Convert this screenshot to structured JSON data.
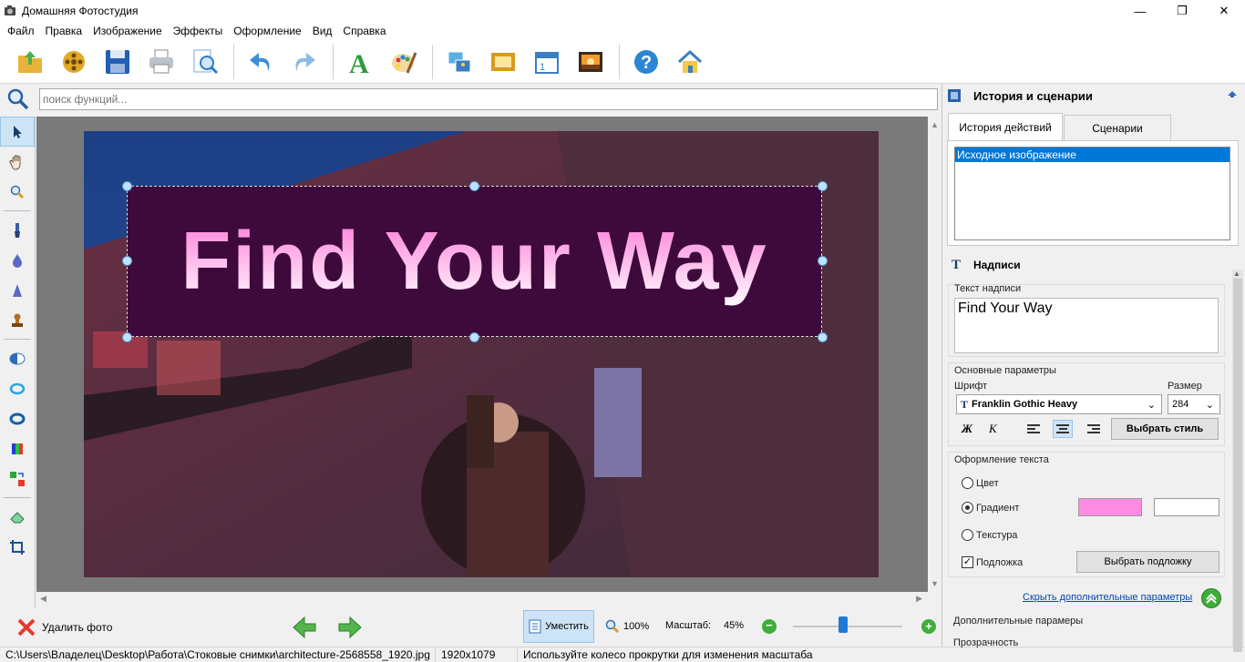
{
  "window": {
    "title": "Домашняя Фотостудия"
  },
  "menu": [
    "Файл",
    "Правка",
    "Изображение",
    "Эффекты",
    "Оформление",
    "Вид",
    "Справка"
  ],
  "toolbar_icons": [
    "open-folder-icon",
    "film-reel-icon",
    "save-icon",
    "print-icon",
    "zoom-preview-icon",
    "undo-icon",
    "redo-icon",
    "text-icon",
    "palette-icon",
    "collage-icon",
    "frame-icon",
    "calendar-icon",
    "postcard-icon",
    "help-icon",
    "home-icon"
  ],
  "search": {
    "placeholder": "поиск функций..."
  },
  "canvas": {
    "caption_text": "Find Your Way",
    "gradient_start": "#ff7ad8",
    "gradient_end": "#ffffff",
    "background_color": "#3e0a3c"
  },
  "bottom": {
    "delete_label": "Удалить фото",
    "fit_label": "Уместить",
    "zoom100_label": "100%",
    "scale_label": "Масштаб:",
    "scale_value": "45%",
    "slider_level": 0.45
  },
  "status": {
    "path": "C:\\Users\\Владелец\\Desktop\\Работа\\Стоковые снимки\\architecture-2568558_1920.jpg",
    "size": "1920x1079",
    "hint": "Используйте колесо прокрутки для изменения масштаба"
  },
  "history": {
    "title": "История и сценарии",
    "tabs": [
      "История действий",
      "Сценарии"
    ],
    "items": [
      "Исходное изображение"
    ]
  },
  "captions": {
    "title": "Надписи",
    "text_label": "Текст надписи",
    "text_value": "Find Your Way",
    "basic_params": "Основные параметры",
    "font_label": "Шрифт",
    "font_value": "Franklin Gothic Heavy",
    "size_label": "Размер",
    "size_value": "284",
    "bold_label": "Ж",
    "italic_label": "К",
    "choose_style": "Выбрать стиль",
    "design_label": "Оформление текста",
    "color_label": "Цвет",
    "gradient_label": "Градиент",
    "texture_label": "Текстура",
    "backing_label": "Подложка",
    "choose_backing": "Выбрать подложку",
    "hide_params": "Скрыть дополнительные параметры",
    "extra_params": "Дополнительные парамеры",
    "transparency": "Прозрачность"
  },
  "colors": {
    "accent": "#0078d7",
    "link": "#0645ad",
    "gradient_swatch": "#ff8ce0",
    "gradient_swatch2": "#ffffff"
  }
}
